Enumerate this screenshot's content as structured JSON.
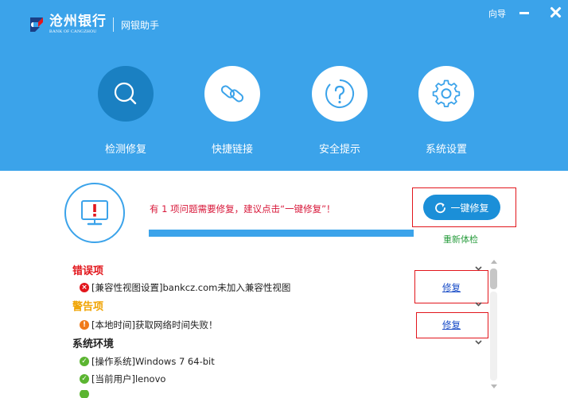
{
  "app": {
    "bank_name": "沧州银行",
    "bank_name_en": "BANK OF CANGZHOU",
    "product": "网银助手"
  },
  "window": {
    "guide_label": "向导"
  },
  "nav": {
    "items": [
      {
        "label": "检测修复",
        "icon": "search-icon",
        "active": true
      },
      {
        "label": "快捷链接",
        "icon": "link-icon",
        "active": false
      },
      {
        "label": "安全提示",
        "icon": "question-icon",
        "active": false
      },
      {
        "label": "系统设置",
        "icon": "gear-icon",
        "active": false
      }
    ]
  },
  "status": {
    "message": "有 1 项问题需要修复，建议点击“一键修复”！",
    "fix_all_label": "一键修复",
    "recheck_label": "重新体检",
    "progress": 1.0
  },
  "results": {
    "error": {
      "title": "错误项",
      "items": [
        {
          "text": "[兼容性视图设置]bankcz.com未加入兼容性视图",
          "action": "修复"
        }
      ]
    },
    "warning": {
      "title": "警告项",
      "items": [
        {
          "text": "[本地时间]获取网络时间失败！",
          "action": "修复"
        }
      ]
    },
    "environment": {
      "title": "系统环境",
      "items": [
        {
          "text": "[操作系统]Windows 7 64-bit"
        },
        {
          "text": "[当前用户]lenovo"
        }
      ]
    }
  },
  "colors": {
    "header_bg": "#3ba3ea",
    "active_nav": "#1a80c2",
    "error": "#e2161c",
    "warning": "#f0a300",
    "ok": "#5bb531",
    "highlight_box": "#e2161c"
  }
}
